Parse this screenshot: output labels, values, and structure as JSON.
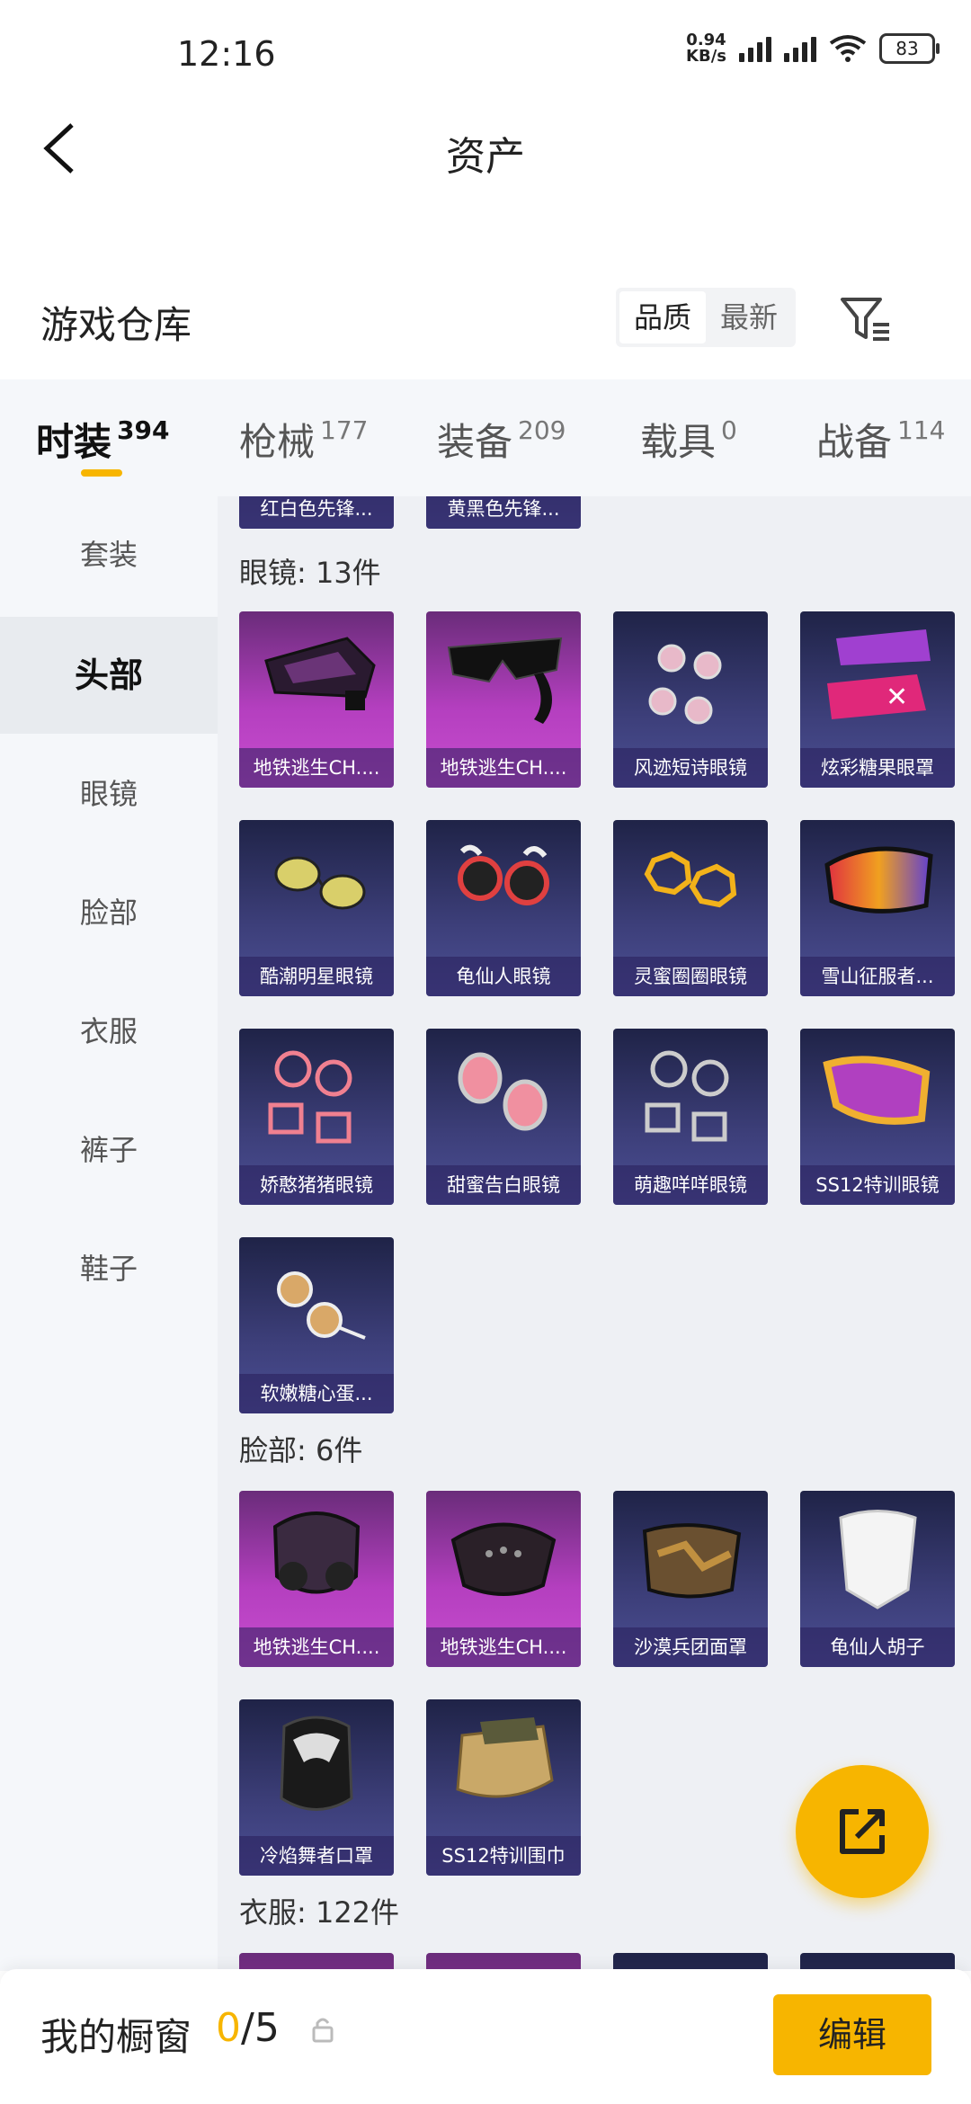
{
  "status": {
    "time": "12:16",
    "net_speed": "0.94",
    "net_unit": "KB/s",
    "battery": "83"
  },
  "header": {
    "title": "资产"
  },
  "section": {
    "title": "游戏仓库",
    "sort_options": [
      "品质",
      "最新"
    ],
    "active_sort": "品质"
  },
  "tabs": [
    {
      "label": "时装",
      "count": "394"
    },
    {
      "label": "枪械",
      "count": "177"
    },
    {
      "label": "装备",
      "count": "209"
    },
    {
      "label": "载具",
      "count": "0"
    },
    {
      "label": "战备",
      "count": "114"
    }
  ],
  "sidebar": {
    "items": [
      "套装",
      "头部",
      "眼镜",
      "脸部",
      "衣服",
      "裤子",
      "鞋子"
    ],
    "active": "头部"
  },
  "content": {
    "partial_top": [
      "红白色先锋...",
      "黄黑色先锋..."
    ],
    "glasses": {
      "title": "眼镜: 13件",
      "items": [
        "地铁逃生CH....",
        "地铁逃生CH....",
        "风迹短诗眼镜",
        "炫彩糖果眼罩",
        "酷潮明星眼镜",
        "龟仙人眼镜",
        "灵蜜圈圈眼镜",
        "雪山征服者...",
        "娇憨猪猪眼镜",
        "甜蜜告白眼镜",
        "萌趣咩咩眼镜",
        "SS12特训眼镜",
        "软嫩糖心蛋..."
      ]
    },
    "face": {
      "title": "脸部: 6件",
      "items": [
        "地铁逃生CH....",
        "地铁逃生CH....",
        "沙漠兵团面罩",
        "龟仙人胡子",
        "冷焰舞者口罩",
        "SS12特训围巾"
      ]
    },
    "clothes": {
      "title": "衣服: 122件"
    }
  },
  "bottom": {
    "title": "我的橱窗",
    "current": "0",
    "total": "/5",
    "edit_label": "编辑"
  },
  "colors": {
    "accent": "#f7b500",
    "card_purple": "#b43fbf",
    "card_blue": "#3d3f7a"
  }
}
